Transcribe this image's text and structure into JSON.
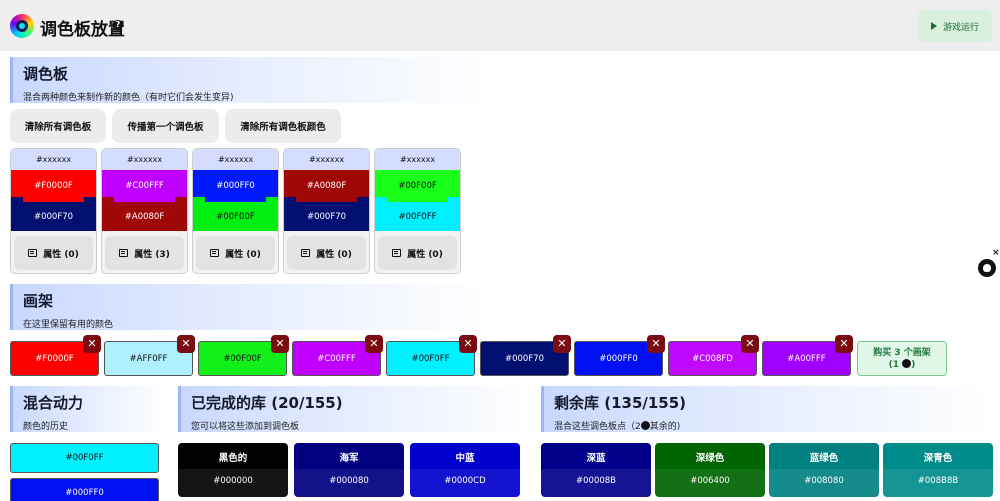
{
  "header": {
    "title": "调色板放置",
    "help": "?",
    "run_button": "游戏运行"
  },
  "palette_section": {
    "title": "调色板",
    "subtitle": "混合两种颜色来制作新的颜色（有时它们会发生变异)",
    "buttons": [
      "清除所有调色板",
      "传播第一个调色板",
      "清除所有调色板颜色"
    ],
    "cards": [
      {
        "top_hex": "#xxxxxx",
        "c1": "#F0000F",
        "c1_color": "#ff0000",
        "c1_text": "#ffffff",
        "c2": "#000F70",
        "c2_color": "#000f70",
        "c2_text": "#ffffff",
        "mix_l": "#000f70",
        "mix_r": "#000f70",
        "props": "属性 (0)"
      },
      {
        "top_hex": "#xxxxxx",
        "c1": "#C00FFF",
        "c1_color": "#c000ff",
        "c1_text": "#ffffff",
        "c2": "#A0080F",
        "c2_color": "#a00808",
        "c2_text": "#ffffff",
        "mix_l": "#a00808",
        "mix_r": "#a00808",
        "props": "属性 (3)"
      },
      {
        "top_hex": "#xxxxxx",
        "c1": "#000FF0",
        "c1_color": "#0019ff",
        "c1_text": "#ffffff",
        "c2": "#00F00F",
        "c2_color": "#00ee10",
        "c2_text": "#111111",
        "mix_l": "#00ee10",
        "mix_r": "#00ee10",
        "props": "属性 (0)"
      },
      {
        "top_hex": "#xxxxxx",
        "c1": "#A0080F",
        "c1_color": "#a00808",
        "c1_text": "#ffffff",
        "c2": "#000F70",
        "c2_color": "#000f70",
        "c2_text": "#ffffff",
        "mix_l": "#000f70",
        "mix_r": "#000f70",
        "props": "属性 (0)"
      },
      {
        "top_hex": "#xxxxxx",
        "c1": "#00F00F",
        "c1_color": "#1aff1a",
        "c1_text": "#111111",
        "c2": "#00F0FF",
        "c2_color": "#00f0ff",
        "c2_text": "#111111",
        "mix_l": "#00f0ff",
        "mix_r": "#00f0ff",
        "props": "属性 (0)"
      }
    ]
  },
  "shelf_section": {
    "title": "画架",
    "subtitle": "在这里保留有用的颜色",
    "items": [
      {
        "hex": "#F0000F",
        "color": "#ff0000",
        "text": "#ffffff"
      },
      {
        "hex": "#AFF0FF",
        "color": "#aff0ff",
        "text": "#111111"
      },
      {
        "hex": "#00F00F",
        "color": "#12f01a",
        "text": "#111111"
      },
      {
        "hex": "#C00FFF",
        "color": "#c000ff",
        "text": "#ffffff"
      },
      {
        "hex": "#00F0FF",
        "color": "#00f0ff",
        "text": "#111111"
      },
      {
        "hex": "#000F70",
        "color": "#000f70",
        "text": "#ffffff"
      },
      {
        "hex": "#000FF0",
        "color": "#0010f0",
        "text": "#ffffff"
      },
      {
        "hex": "#C008FD",
        "color": "#c008fd",
        "text": "#ffffff"
      },
      {
        "hex": "#A00FFF",
        "color": "#a000ff",
        "text": "#ffffff"
      }
    ],
    "remove_label": "✕",
    "buy_line1": "购买 3 个画架",
    "buy_line2": "(1",
    "buy_line2_end": ")"
  },
  "history_section": {
    "title": "混合动力",
    "subtitle": "颜色的历史",
    "items": [
      {
        "hex": "#00F0FF",
        "color": "#00f0ff",
        "text": "#111111"
      },
      {
        "hex": "#000FF0",
        "color": "#0010f0",
        "text": "#ffffff"
      }
    ]
  },
  "done_section": {
    "title": "已完成的库 (20/155)",
    "subtitle": "您可以将这些添加到调色板",
    "tiles": [
      {
        "name": "黑色的",
        "hex": "#000000",
        "color": "#000000"
      },
      {
        "name": "海军",
        "hex": "#000080",
        "color": "#000080"
      },
      {
        "name": "中蓝",
        "hex": "#0000CD",
        "color": "#0000cd"
      }
    ]
  },
  "remaining_section": {
    "title": "剩余库 (135/155)",
    "subtitle_a": "混合这些调色板点（2",
    "subtitle_b": "其余的)",
    "tiles": [
      {
        "name": "深蓝",
        "hex": "#00008B",
        "color": "#00008b"
      },
      {
        "name": "深绿色",
        "hex": "#006400",
        "color": "#006400"
      },
      {
        "name": "蓝绿色",
        "hex": "#008080",
        "color": "#008080"
      },
      {
        "name": "深青色",
        "hex": "#008B8B",
        "color": "#008b8b"
      }
    ]
  },
  "side": {
    "close": "×",
    "github_icon": "github-icon"
  }
}
